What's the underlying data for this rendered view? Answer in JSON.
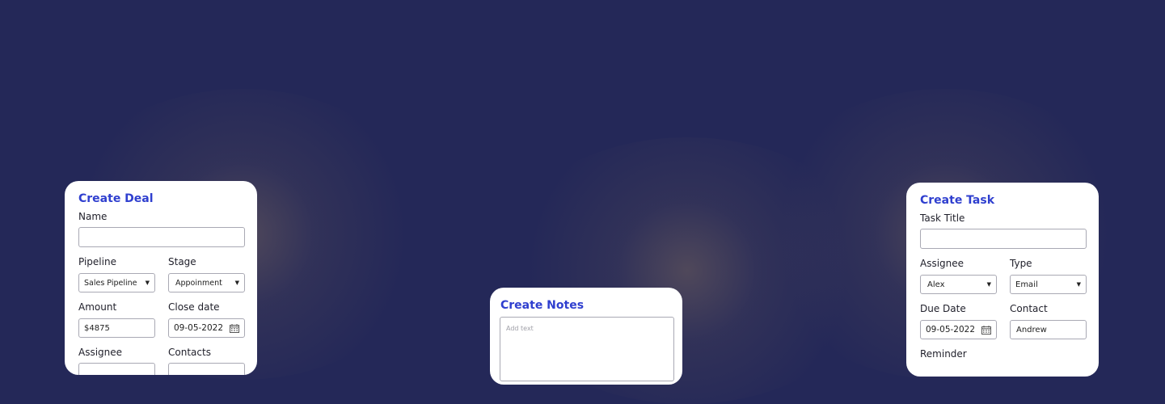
{
  "deal": {
    "title": "Create Deal",
    "name_label": "Name",
    "name_value": "",
    "pipeline_label": "Pipeline",
    "pipeline_value": "Sales Pipeline",
    "stage_label": "Stage",
    "stage_value": "Appoinment",
    "amount_label": "Amount",
    "amount_value": "$4875",
    "close_date_label": "Close date",
    "close_date_value": "09-05-2022",
    "assignee_label": "Assignee",
    "contacts_label": "Contacts"
  },
  "notes": {
    "title": "Create Notes",
    "placeholder": "Add text"
  },
  "task": {
    "title": "Create Task",
    "task_title_label": "Task Title",
    "task_title_value": "",
    "assignee_label": "Assignee",
    "assignee_value": "Alex",
    "type_label": "Type",
    "type_value": "Email",
    "due_date_label": "Due Date",
    "due_date_value": "09-05-2022",
    "contact_label": "Contact",
    "contact_value": "Andrew",
    "reminder_label": "Reminder"
  },
  "icons": {
    "dropdown": "chevron-down-icon",
    "calendar": "calendar-icon"
  },
  "colors": {
    "background": "#242858",
    "card": "#ffffff",
    "title_accent": "#2f3fcf"
  }
}
